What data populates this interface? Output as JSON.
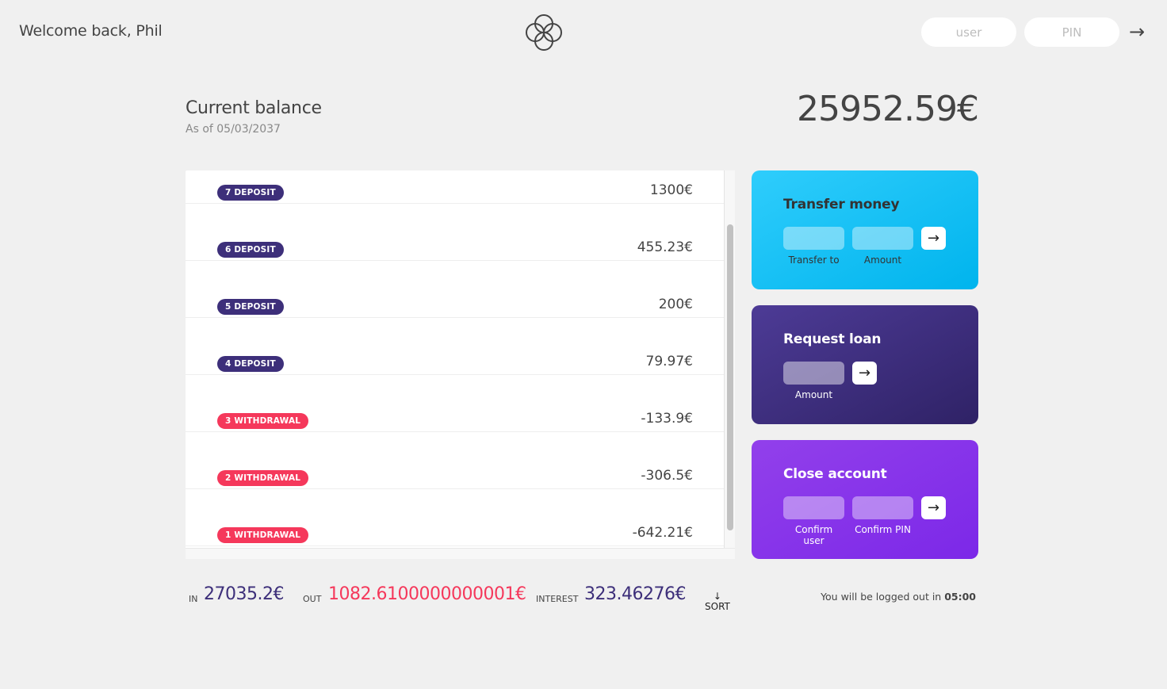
{
  "nav": {
    "welcome": "Welcome back, Phil",
    "user_placeholder": "user",
    "pin_placeholder": "PIN",
    "login_button": "→"
  },
  "balance": {
    "label": "Current balance",
    "date": "As of 05/03/2037",
    "value": "25952.59€"
  },
  "movements": [
    {
      "type": "7 deposit",
      "kind": "deposit",
      "value": "1300€"
    },
    {
      "type": "6 deposit",
      "kind": "deposit",
      "value": "455.23€"
    },
    {
      "type": "5 deposit",
      "kind": "deposit",
      "value": "200€"
    },
    {
      "type": "4 deposit",
      "kind": "deposit",
      "value": "79.97€"
    },
    {
      "type": "3 withdrawal",
      "kind": "withdrawal",
      "value": "-133.9€"
    },
    {
      "type": "2 withdrawal",
      "kind": "withdrawal",
      "value": "-306.5€"
    },
    {
      "type": "1 withdrawal",
      "kind": "withdrawal",
      "value": "-642.21€"
    }
  ],
  "operations": {
    "transfer": {
      "title": "Transfer money",
      "label_to": "Transfer to",
      "label_amount": "Amount",
      "button": "→"
    },
    "loan": {
      "title": "Request loan",
      "label_amount": "Amount",
      "button": "→"
    },
    "close": {
      "title": "Close account",
      "label_user": "Confirm user",
      "label_pin": "Confirm PIN",
      "button": "→"
    }
  },
  "summary": {
    "in_label": "In",
    "in_value": "27035.2€",
    "out_label": "Out",
    "out_value": "1082.6100000000001€",
    "interest_label": "Interest",
    "interest_value": "323.46276€",
    "sort_arrow": "↓",
    "sort_label": "SORT",
    "logout_text": "You will be logged out in ",
    "timer": "05:00"
  },
  "colors": {
    "deposit": "#3d2f7a",
    "withdrawal": "#f5385b",
    "transfer_card": "#00b4ed",
    "loan_card": "#3d2f7a",
    "close_card": "#8a35ea",
    "background": "#f0f0f0"
  }
}
